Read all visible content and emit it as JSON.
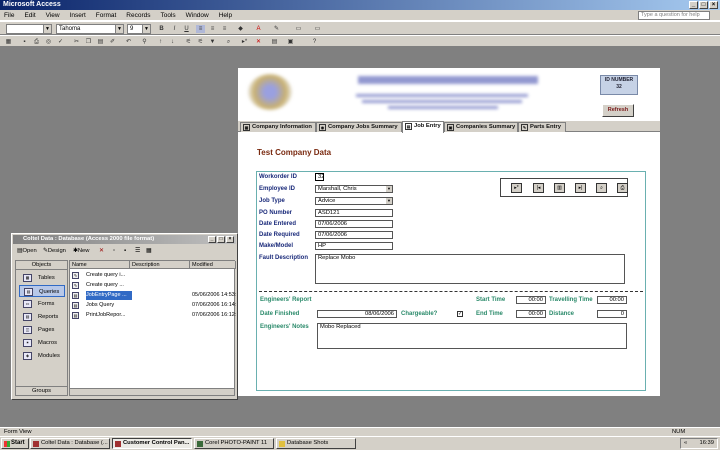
{
  "app": {
    "title": "Microsoft Access"
  },
  "menu": [
    "File",
    "Edit",
    "View",
    "Insert",
    "Format",
    "Records",
    "Tools",
    "Window",
    "Help"
  ],
  "help": {
    "placeholder": "Type a question for help"
  },
  "toolbar": {
    "font": "Tahoma",
    "size": "9"
  },
  "form": {
    "id_number_label": "ID NUMBER",
    "id_number_value": "32",
    "refresh_label": "Refresh",
    "tabs": [
      "Company Information",
      "Company Jobs Summary",
      "Job Entry",
      "Companies Summary",
      "Parts Entry"
    ],
    "company_name": "Test Company Data",
    "fields": {
      "workorder_id_label": "Workorder ID",
      "workorder_id": "32",
      "employee_id_label": "Employee ID",
      "employee_id": "Marshall, Chris",
      "job_type_label": "Job Type",
      "job_type": "Advice",
      "po_number_label": "PO Number",
      "po_number": "ASD121",
      "date_entered_label": "Date Entered",
      "date_entered": "07/06/2006",
      "date_required_label": "Date Required",
      "date_required": "07/06/2006",
      "make_model_label": "Make/Model",
      "make_model": "HP",
      "fault_description_label": "Fault Description",
      "fault_description": "Replace Mobo"
    },
    "engineers": {
      "report_label": "Engineers' Report",
      "start_time_label": "Start Time",
      "start_time": "00:00",
      "travelling_time_label": "Travelling Time",
      "travelling_time": "00:00",
      "date_finished_label": "Date Finished",
      "date_finished": "08/06/2006",
      "chargeable_label": "Chargeable?",
      "end_time_label": "End Time",
      "end_time": "00:00",
      "distance_label": "Distance",
      "distance": "0",
      "notes_label": "Engineers' Notes",
      "notes": "Mobo Replaced"
    }
  },
  "db_window": {
    "title": "Coltel Data : Database (Access 2000 file format)",
    "open": "Open",
    "design": "Design",
    "new": "New",
    "objects_header": "Objects",
    "objects": [
      "Tables",
      "Queries",
      "Forms",
      "Reports",
      "Pages",
      "Macros",
      "Modules"
    ],
    "groups": "Groups",
    "col_name": "Name",
    "col_description": "Description",
    "col_modified": "Modified",
    "rows": [
      {
        "name": "Create query i...",
        "modified": ""
      },
      {
        "name": "Create query ...",
        "modified": ""
      },
      {
        "name": "JobEntryPage ...",
        "modified": "05/06/2006 14:53:"
      },
      {
        "name": "Jobs Query",
        "modified": "07/06/2006 16:14:"
      },
      {
        "name": "PrintJobRepor...",
        "modified": "07/06/2006 16:12:"
      }
    ]
  },
  "status": {
    "left": "Form View",
    "right": "NUM"
  },
  "taskbar": {
    "start": "Start",
    "tasks": [
      "Coltel Data : Database (...",
      "Customer Control Pan...",
      "Corel PHOTO-PAINT 11",
      "Database Shots"
    ],
    "time": "16:39"
  }
}
